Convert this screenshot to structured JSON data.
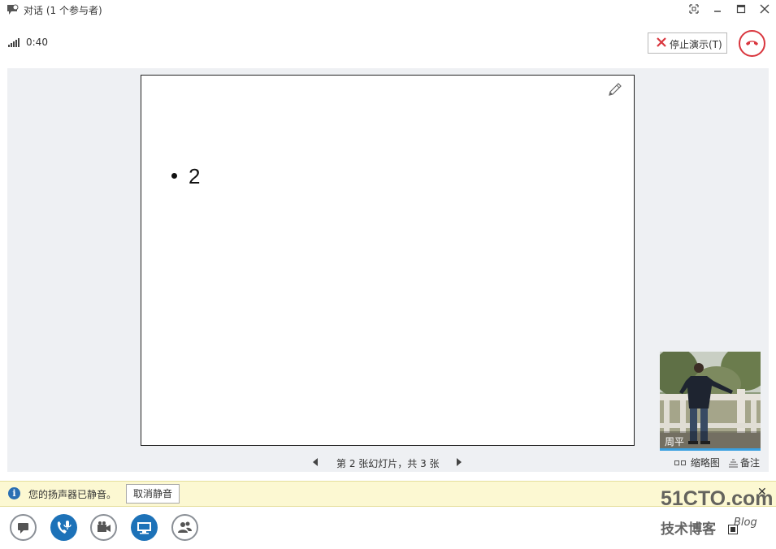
{
  "window": {
    "title": "对话 (1 个参与者)"
  },
  "call": {
    "timer": "0:40",
    "stop_presenting_label": "停止演示(T)"
  },
  "slide": {
    "bullet_text": "2",
    "counter_text": "第 2 张幻灯片，共 3 张"
  },
  "video": {
    "participant_name": "周平"
  },
  "view_options": {
    "thumbnails_label": "缩略图",
    "notes_label": "备注"
  },
  "notification": {
    "message": "您的扬声器已静音。",
    "unmute_label": "取消静音"
  },
  "watermark": {
    "site": "51CTO.com",
    "tagline": "技术博客",
    "blog": "Blog"
  },
  "colors": {
    "accent_blue": "#1d72b8",
    "hangup_red": "#d9363e",
    "notify_bg": "#fcf8d2"
  },
  "icons": [
    "conversation-icon",
    "minimize-icon",
    "maximize-icon",
    "close-icon",
    "fullscreen-icon",
    "signal-icon",
    "hangup-icon",
    "pencil-icon",
    "chat-icon",
    "phone-mic-icon",
    "video-camera-icon",
    "present-screen-icon",
    "participants-icon"
  ]
}
